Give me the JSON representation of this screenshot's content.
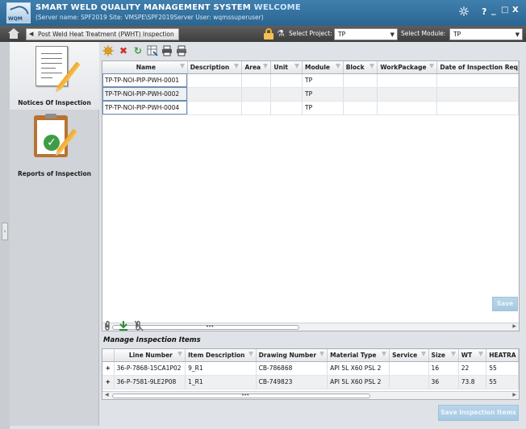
{
  "app": {
    "title": "SMART WELD QUALITY MANAGEMENT SYSTEM",
    "welcome": "WELCOME",
    "subtitle": "(Server name: SPF2019 Site: VMSPE\\SPF2019Server User: wqmssuperuser)",
    "logo_text": "WQM",
    "window_controls": [
      "?",
      "_",
      "□",
      "X"
    ]
  },
  "toolbar": {
    "breadcrumb": "Post Weld Heat Treatment (PWHT) Inspection",
    "project_label": "Select Project:",
    "project_value": "TP",
    "module_label": "Select Module:",
    "module_value": "TP"
  },
  "sidebar": {
    "items": [
      {
        "label": "Notices Of Inspection"
      },
      {
        "label": "Reports of Inspection"
      }
    ]
  },
  "notices_grid": {
    "columns": [
      "Name",
      "Description",
      "Area",
      "Unit",
      "Module",
      "Block",
      "WorkPackage",
      "Date of Inspection Req"
    ],
    "rows": [
      [
        "TP-TP-NOI-PIP-PWH-0001",
        "",
        "",
        "",
        "TP",
        "",
        "",
        ""
      ],
      [
        "TP-TP-NOI-PIP-PWH-0002",
        "",
        "",
        "",
        "TP",
        "",
        "",
        ""
      ],
      [
        "TP-TP-NOI-PIP-PWH-0004",
        "",
        "",
        "",
        "TP",
        "",
        "",
        ""
      ]
    ],
    "save_label": "Save"
  },
  "inspection_items": {
    "title": "Manage Inspection Items",
    "columns": [
      "",
      "Line Number",
      "Item Description",
      "Drawing Number",
      "Material Type",
      "Service",
      "Size",
      "WT",
      "HEATRA"
    ],
    "rows": [
      [
        "+",
        "36-P-7868-15CA1P02",
        "9_R1",
        "CB-786868",
        "API 5L X60 PSL 2",
        "",
        "16",
        "22",
        "55"
      ],
      [
        "+",
        "36-P-7581-9LE2P08",
        "1_R1",
        "CB-749823",
        "API 5L X60 PSL 2",
        "",
        "36",
        "73.8",
        "55"
      ]
    ],
    "save_label": "Save Inspection Items"
  },
  "colors": {
    "title_bar": "#2f6c9d",
    "toolbar": "#4a4a4a",
    "disabled_button": "#a9cce4"
  }
}
